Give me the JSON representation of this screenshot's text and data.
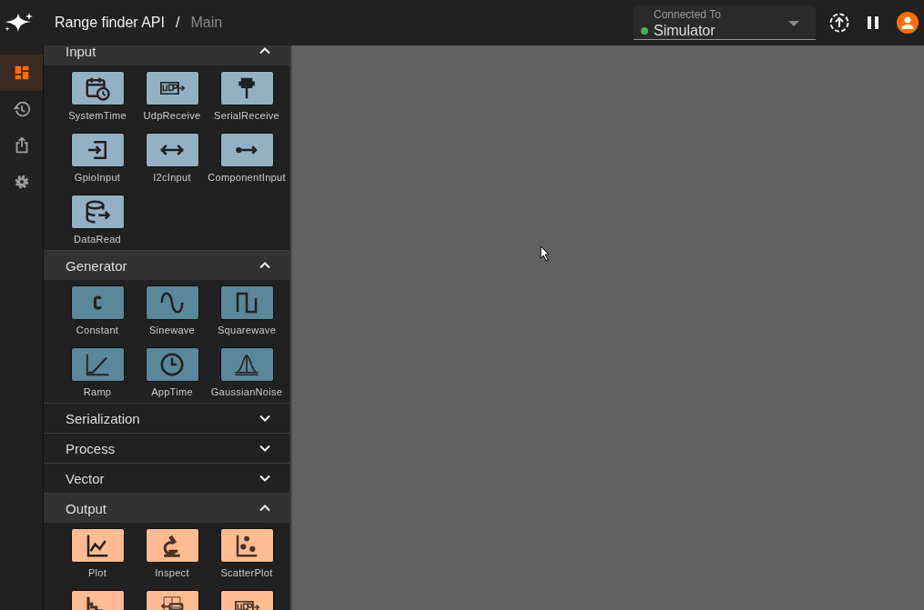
{
  "header": {
    "project": "Range finder API",
    "separator": "/",
    "page": "Main"
  },
  "connection": {
    "label": "Connected To",
    "value": "Simulator",
    "color": "#4caf50"
  },
  "rail": [
    {
      "selected": true
    },
    {
      "selected": false
    },
    {
      "selected": false
    },
    {
      "selected": false
    }
  ],
  "palette": [
    {
      "title": "Input",
      "expanded": true,
      "color": "#93b1c2",
      "items": [
        {
          "label": "SystemTime"
        },
        {
          "label": "UdpReceive"
        },
        {
          "label": "SerialReceive"
        },
        {
          "label": "GpioInput"
        },
        {
          "label": "I2cInput"
        },
        {
          "label": "ComponentInput"
        },
        {
          "label": "DataRead"
        }
      ]
    },
    {
      "title": "Generator",
      "expanded": true,
      "color": "#5a8799",
      "items": [
        {
          "label": "Constant"
        },
        {
          "label": "Sinewave"
        },
        {
          "label": "Squarewave"
        },
        {
          "label": "Ramp"
        },
        {
          "label": "AppTime"
        },
        {
          "label": "GaussianNoise"
        }
      ]
    },
    {
      "title": "Serialization",
      "expanded": false
    },
    {
      "title": "Process",
      "expanded": false
    },
    {
      "title": "Vector",
      "expanded": false
    },
    {
      "title": "Output",
      "expanded": true,
      "color": "#ffbb91",
      "items": [
        {
          "label": "Plot"
        },
        {
          "label": "Inspect"
        },
        {
          "label": "ScatterPlot"
        },
        {
          "kind": "cut"
        },
        {
          "kind": "cut"
        },
        {
          "kind": "cut"
        }
      ]
    }
  ]
}
